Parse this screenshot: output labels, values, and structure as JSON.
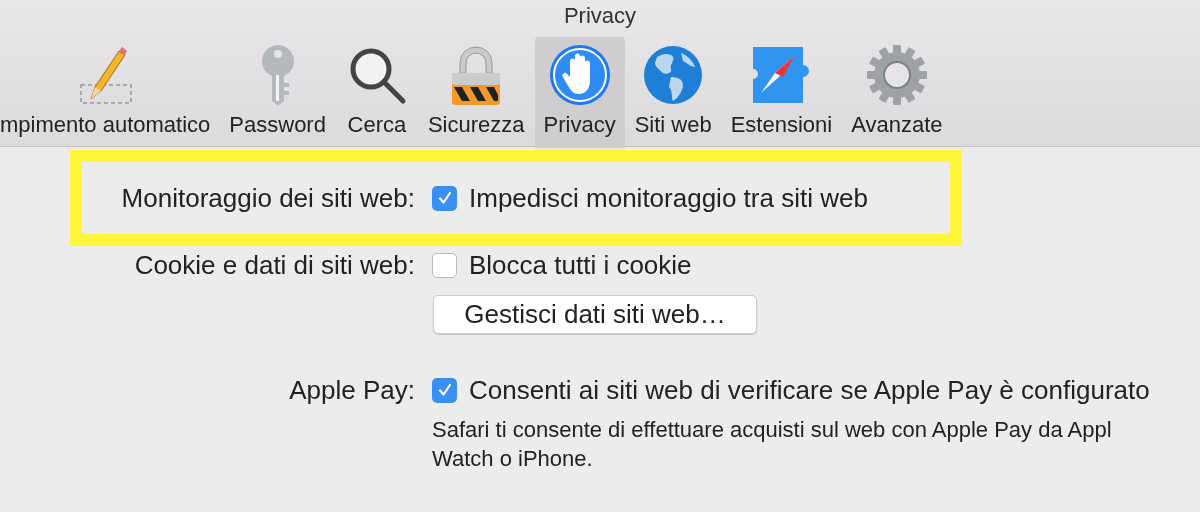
{
  "window": {
    "title": "Privacy"
  },
  "toolbar": [
    {
      "label": "mpimento automatico",
      "selected": false
    },
    {
      "label": "Password",
      "selected": false
    },
    {
      "label": "Cerca",
      "selected": false
    },
    {
      "label": "Sicurezza",
      "selected": false
    },
    {
      "label": "Privacy",
      "selected": true
    },
    {
      "label": "Siti web",
      "selected": false
    },
    {
      "label": "Estensioni",
      "selected": false
    },
    {
      "label": "Avanzate",
      "selected": false
    }
  ],
  "settings": [
    {
      "kind": "checkbox",
      "label": "Monitoraggio dei siti web:",
      "option": "Impedisci monitoraggio tra siti web",
      "checked": true,
      "highlighted": true
    },
    {
      "kind": "checkbox",
      "label": "Cookie e dati di siti web:",
      "option": "Blocca tutti i cookie",
      "checked": false,
      "highlighted": false
    },
    {
      "kind": "button",
      "text": "Gestisci dati siti web…"
    },
    {
      "kind": "checkbox",
      "label": "Apple Pay:",
      "option": "Consenti ai siti web di verificare se Apple Pay è configurato",
      "checked": true,
      "highlighted": false,
      "note": [
        "Safari ti consente di effettuare acquisti sul web con Apple Pay da Appl",
        "Watch o iPhone."
      ]
    }
  ]
}
